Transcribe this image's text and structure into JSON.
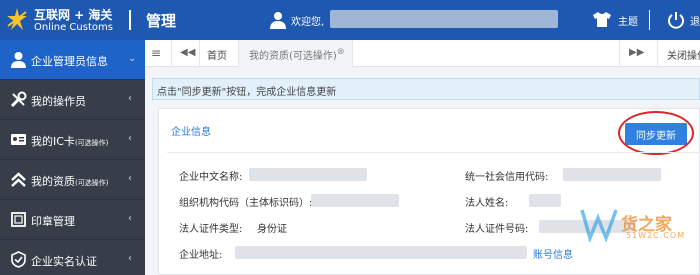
{
  "header": {
    "logo_cn": "互联网 + 海关",
    "logo_en": "Online Customs",
    "title": "管理",
    "welcome": "欢迎您,",
    "theme_label": "主题",
    "exit_label": "退"
  },
  "sidebar": {
    "items": [
      {
        "label": "企业管理员信息",
        "small": "",
        "icon": "user-icon",
        "active": true
      },
      {
        "label": "我的操作员",
        "small": "",
        "icon": "tools-icon",
        "active": false
      },
      {
        "label": "我的IC卡",
        "small": "(可选操作)",
        "icon": "id-card-icon",
        "active": false
      },
      {
        "label": "我的资质",
        "small": "(可选操作)",
        "icon": "chevrons-up-icon",
        "active": false
      },
      {
        "label": "印章管理",
        "small": "",
        "icon": "stamp-icon",
        "active": false
      },
      {
        "label": "企业实名认证",
        "small": "",
        "icon": "shield-check-icon",
        "active": false
      }
    ]
  },
  "tabs": {
    "home": "首页",
    "active_tab": "我的资质(可选操作)",
    "close_ops": "关闭操作"
  },
  "hint": "点击\"同步更新\"按钮，完成企业信息更新",
  "panel": {
    "title": "企业信息",
    "sync_button": "同步更新",
    "fields": {
      "cn_name_label": "企业中文名称:",
      "credit_code_label": "统一社会信用代码:",
      "org_code_label": "组织机构代码（主体标识码）:",
      "legal_name_label": "法人姓名:",
      "id_type_label": "法人证件类型:",
      "id_type_value": "身份证",
      "id_no_label": "法人证件号码:",
      "address_label": "企业地址:",
      "account_info_link": "账号信息"
    }
  },
  "watermark": {
    "brand": "货之家",
    "domain": "51W2C.COM"
  },
  "colors": {
    "topbar": "#1f58b0",
    "sidebar": "#373d49",
    "active": "#1e64c8",
    "accent": "#2f80e0",
    "highlight_ring": "#e0262b"
  }
}
